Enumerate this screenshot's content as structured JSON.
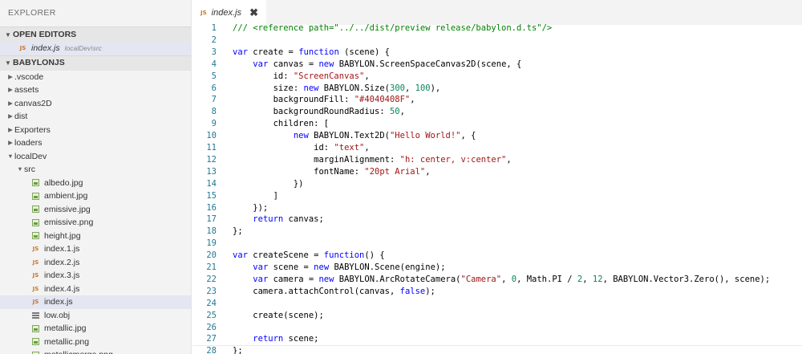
{
  "sidebar": {
    "title": "EXPLORER",
    "open_editors": {
      "header": "OPEN EDITORS",
      "items": [
        {
          "icon": "js",
          "label": "index.js",
          "path": "localDev\\src"
        }
      ]
    },
    "project": {
      "header": "BABYLONJS",
      "items": [
        {
          "label": ".vscode",
          "depth": 0,
          "kind": "folder",
          "expanded": false
        },
        {
          "label": "assets",
          "depth": 0,
          "kind": "folder",
          "expanded": false
        },
        {
          "label": "canvas2D",
          "depth": 0,
          "kind": "folder",
          "expanded": false
        },
        {
          "label": "dist",
          "depth": 0,
          "kind": "folder",
          "expanded": false
        },
        {
          "label": "Exporters",
          "depth": 0,
          "kind": "folder",
          "expanded": false
        },
        {
          "label": "loaders",
          "depth": 0,
          "kind": "folder",
          "expanded": false
        },
        {
          "label": "localDev",
          "depth": 0,
          "kind": "folder",
          "expanded": true
        },
        {
          "label": "src",
          "depth": 1,
          "kind": "folder",
          "expanded": true
        },
        {
          "label": "albedo.jpg",
          "depth": 2,
          "kind": "image"
        },
        {
          "label": "ambient.jpg",
          "depth": 2,
          "kind": "image"
        },
        {
          "label": "emissive.jpg",
          "depth": 2,
          "kind": "image"
        },
        {
          "label": "emissive.png",
          "depth": 2,
          "kind": "image"
        },
        {
          "label": "height.jpg",
          "depth": 2,
          "kind": "image"
        },
        {
          "label": "index.1.js",
          "depth": 2,
          "kind": "js"
        },
        {
          "label": "index.2.js",
          "depth": 2,
          "kind": "js"
        },
        {
          "label": "index.3.js",
          "depth": 2,
          "kind": "js"
        },
        {
          "label": "index.4.js",
          "depth": 2,
          "kind": "js"
        },
        {
          "label": "index.js",
          "depth": 2,
          "kind": "js",
          "selected": true
        },
        {
          "label": "low.obj",
          "depth": 2,
          "kind": "obj"
        },
        {
          "label": "metallic.jpg",
          "depth": 2,
          "kind": "image"
        },
        {
          "label": "metallic.png",
          "depth": 2,
          "kind": "image"
        },
        {
          "label": "metallicmerge.png",
          "depth": 2,
          "kind": "image"
        }
      ]
    }
  },
  "editor": {
    "tab": {
      "icon": "js",
      "label": "index.js",
      "close": "✖"
    },
    "current_line": 28,
    "lines": [
      [
        [
          "cm",
          "/// <reference path=\"../../dist/preview release/babylon.d.ts\"/>"
        ]
      ],
      [],
      [
        [
          "kw",
          "var"
        ],
        [
          "tx",
          " create = "
        ],
        [
          "kw",
          "function"
        ],
        [
          "tx",
          " (scene) {"
        ]
      ],
      [
        [
          "tx",
          "    "
        ],
        [
          "kw",
          "var"
        ],
        [
          "tx",
          " canvas = "
        ],
        [
          "kw",
          "new"
        ],
        [
          "tx",
          " BABYLON.ScreenSpaceCanvas2D(scene, {"
        ]
      ],
      [
        [
          "tx",
          "        id: "
        ],
        [
          "str",
          "\"ScreenCanvas\""
        ],
        [
          "tx",
          ","
        ]
      ],
      [
        [
          "tx",
          "        size: "
        ],
        [
          "kw",
          "new"
        ],
        [
          "tx",
          " BABYLON.Size("
        ],
        [
          "num",
          "300"
        ],
        [
          "tx",
          ", "
        ],
        [
          "num",
          "100"
        ],
        [
          "tx",
          "),"
        ]
      ],
      [
        [
          "tx",
          "        backgroundFill: "
        ],
        [
          "str",
          "\"#4040408F\""
        ],
        [
          "tx",
          ","
        ]
      ],
      [
        [
          "tx",
          "        backgroundRoundRadius: "
        ],
        [
          "num",
          "50"
        ],
        [
          "tx",
          ","
        ]
      ],
      [
        [
          "tx",
          "        children: ["
        ]
      ],
      [
        [
          "tx",
          "            "
        ],
        [
          "kw",
          "new"
        ],
        [
          "tx",
          " BABYLON.Text2D("
        ],
        [
          "str",
          "\"Hello World!\""
        ],
        [
          "tx",
          ", {"
        ]
      ],
      [
        [
          "tx",
          "                id: "
        ],
        [
          "str",
          "\"text\""
        ],
        [
          "tx",
          ","
        ]
      ],
      [
        [
          "tx",
          "                marginAlignment: "
        ],
        [
          "str",
          "\"h: center, v:center\""
        ],
        [
          "tx",
          ","
        ]
      ],
      [
        [
          "tx",
          "                fontName: "
        ],
        [
          "str",
          "\"20pt Arial\""
        ],
        [
          "tx",
          ","
        ]
      ],
      [
        [
          "tx",
          "            })"
        ]
      ],
      [
        [
          "tx",
          "        ]"
        ]
      ],
      [
        [
          "tx",
          "    });"
        ]
      ],
      [
        [
          "tx",
          "    "
        ],
        [
          "kw",
          "return"
        ],
        [
          "tx",
          " canvas;"
        ]
      ],
      [
        [
          "tx",
          "};"
        ]
      ],
      [],
      [
        [
          "kw",
          "var"
        ],
        [
          "tx",
          " createScene = "
        ],
        [
          "kw",
          "function"
        ],
        [
          "tx",
          "() {"
        ]
      ],
      [
        [
          "tx",
          "    "
        ],
        [
          "kw",
          "var"
        ],
        [
          "tx",
          " scene = "
        ],
        [
          "kw",
          "new"
        ],
        [
          "tx",
          " BABYLON.Scene(engine);"
        ]
      ],
      [
        [
          "tx",
          "    "
        ],
        [
          "kw",
          "var"
        ],
        [
          "tx",
          " camera = "
        ],
        [
          "kw",
          "new"
        ],
        [
          "tx",
          " BABYLON.ArcRotateCamera("
        ],
        [
          "str",
          "\"Camera\""
        ],
        [
          "tx",
          ", "
        ],
        [
          "num",
          "0"
        ],
        [
          "tx",
          ", Math.PI / "
        ],
        [
          "num",
          "2"
        ],
        [
          "tx",
          ", "
        ],
        [
          "num",
          "12"
        ],
        [
          "tx",
          ", BABYLON.Vector3.Zero(), scene);"
        ]
      ],
      [
        [
          "tx",
          "    camera.attachControl(canvas, "
        ],
        [
          "kw",
          "false"
        ],
        [
          "tx",
          ");"
        ]
      ],
      [],
      [
        [
          "tx",
          "    create(scene);"
        ]
      ],
      [],
      [
        [
          "tx",
          "    "
        ],
        [
          "kw",
          "return"
        ],
        [
          "tx",
          " scene;"
        ]
      ],
      [
        [
          "tx",
          "};"
        ]
      ]
    ]
  },
  "colors": {
    "keyword": "#0000ff",
    "string": "#a31515",
    "number": "#098658",
    "comment": "#008000",
    "line_number": "#237893",
    "js_icon": "#c7772b",
    "selection": "#e4e6f1"
  }
}
